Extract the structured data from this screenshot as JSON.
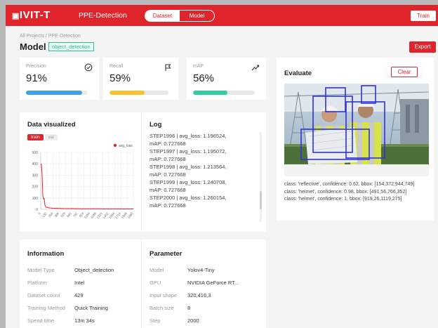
{
  "header": {
    "logo": "IVIT-T",
    "project_name": "PPE-Detection",
    "tabs": [
      {
        "label": "Dataset"
      },
      {
        "label": "Model"
      }
    ],
    "train_label": "Train"
  },
  "breadcrumb": "All Projects / PPE-Detection",
  "page": {
    "title": "Model",
    "tag": "object_detection",
    "export_label": "Export"
  },
  "metrics": [
    {
      "label": "Precision",
      "value": "91%",
      "progress": 0.91,
      "color": "#3fa0ea",
      "icon": "check-circle-icon"
    },
    {
      "label": "Recall",
      "value": "59%",
      "progress": 0.59,
      "color": "#f7c32a",
      "icon": "flag-icon"
    },
    {
      "label": "mAP",
      "value": "56%",
      "progress": 0.56,
      "color": "#2fcf9f",
      "icon": "trend-icon"
    }
  ],
  "data_visualized": {
    "title": "Data visualized",
    "tabs": [
      "train",
      "val"
    ]
  },
  "chart_data": {
    "type": "line",
    "title": "",
    "xlabel": "",
    "ylabel": "",
    "legend": "avg_loss",
    "legend_position": "top-right",
    "ylim": [
      0,
      500
    ],
    "y_ticks": [
      500,
      400,
      300,
      200,
      100,
      0
    ],
    "x_ticks": [
      "0",
      "132",
      "264",
      "396",
      "528",
      "660",
      "792",
      "924",
      "1056",
      "1188",
      "1320",
      "1452",
      "1584",
      "1716",
      "1848",
      "1980"
    ],
    "grid": true,
    "series": [
      {
        "name": "avg_loss",
        "color": "#e0242b",
        "x": [
          0,
          15,
          30,
          45,
          60,
          75,
          90,
          110,
          130,
          160,
          200,
          260,
          330,
          400,
          500,
          700,
          900,
          1200,
          1500,
          1800,
          2000
        ],
        "values": [
          400,
          395,
          300,
          120,
          90,
          95,
          40,
          20,
          18,
          14,
          12,
          10,
          9,
          8,
          7,
          6,
          5,
          5,
          4,
          4,
          4
        ]
      }
    ]
  },
  "log": {
    "title": "Log",
    "lines": [
      "STEP1996 | avg_loss: 1.196524,",
      "mAP: 0.727668",
      "STEP1997 | avg_loss: 1.195072,",
      "mAP: 0.727668",
      "STEP1998 | avg_loss: 1.213564,",
      "mAP: 0.727668",
      "STEP1999 | avg_loss: 1.240708,",
      "mAP: 0.727668",
      "STEP2000 | avg_loss: 1.260154,",
      "mAP: 0.727668"
    ]
  },
  "information": {
    "title": "Information",
    "rows": [
      {
        "key": "Model Type",
        "value": "Object_detection"
      },
      {
        "key": "Platform",
        "value": "Intel"
      },
      {
        "key": "Dataset count",
        "value": "429"
      },
      {
        "key": "Training Method",
        "value": "Quick Training"
      },
      {
        "key": "Spend time",
        "value": "13m 34s"
      }
    ]
  },
  "parameter": {
    "title": "Parameter",
    "rows": [
      {
        "key": "Model",
        "value": "Yolov4-Tiny"
      },
      {
        "key": "GPU",
        "value": "NVIDIA GeForce RT..."
      },
      {
        "key": "Input shape",
        "value": "320,416,3"
      },
      {
        "key": "Batch size",
        "value": "8"
      },
      {
        "key": "Step",
        "value": "2000"
      }
    ]
  },
  "evaluate": {
    "title": "Evaluate",
    "clear_label": "Clear",
    "results": [
      "class: 'reflective', confidence: 0.62, bbox: [154,372,944,749]",
      "class: 'helmet', confidence: 0.98, bbox: [491,56,766,352]",
      "class: 'helmet', confidence: 1, bbox: [919,26,1119,275]"
    ]
  }
}
